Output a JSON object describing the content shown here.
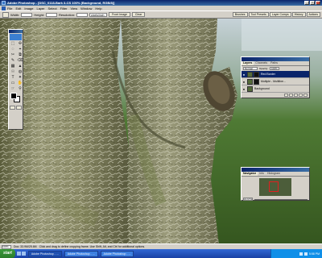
{
  "window": {
    "title": "Adobe Photoshop - [DSC_0118-Bark 3-CS 100% (Background, RGB/8)]",
    "minimize": "_",
    "maximize": "□",
    "close": "x"
  },
  "menu": {
    "items": [
      "File",
      "Edit",
      "Image",
      "Layer",
      "Select",
      "Filter",
      "View",
      "Window",
      "Help"
    ]
  },
  "options_bar": {
    "width_label": "Width:",
    "width_value": "",
    "height_label": "Height:",
    "height_value": "",
    "resolution_label": "Resolution:",
    "resolution_value": "",
    "resolution_units": "pixels/inch",
    "front_image_button": "Front Image",
    "clear_button": "Clear"
  },
  "palette_well": {
    "tabs": [
      "Brushes",
      "Tool Presets",
      "Layer Comps",
      "History",
      "Actions"
    ]
  },
  "toolbox": {
    "tools": [
      "⬚",
      "✣",
      "◌",
      "⌖",
      "✂",
      "⧉",
      "✎",
      "⌫",
      "▦",
      "▲",
      "☉",
      "◍",
      "T",
      "✦",
      "▭",
      "✋",
      "☞",
      "⚲"
    ]
  },
  "layers_panel": {
    "tabs": [
      "Layers",
      "Channels",
      "Paths"
    ],
    "blend_mode": "Normal",
    "opacity_label": "Opacity:",
    "opacity_value": "100%",
    "lock_label": "Lock:",
    "fill_label": "Fill:",
    "fill_value": "100%",
    "layers": [
      {
        "name": "Red Border",
        "selected": true,
        "eye": "●"
      },
      {
        "name": "Multiple - Multiline...",
        "selected": false,
        "eye": "●"
      },
      {
        "name": "Background",
        "selected": false,
        "eye": "●"
      }
    ]
  },
  "navigator_panel": {
    "tabs": [
      "Navigator",
      "Info",
      "Histogram"
    ],
    "zoom_value": "16.67%"
  },
  "status_bar": {
    "zoom": "100%",
    "doc_info": "Doc: 33.9M/25.6M",
    "hint": "Click and drag to define cropping frame. Use Shift, Alt, and Ctrl for additional options."
  },
  "taskbar": {
    "start_label": "start",
    "tasks": [
      "Adobe Photoshop - ...",
      "Adobe Photoshop - ...",
      "Adobe Photoshop - ..."
    ],
    "clock": "5:58 PM"
  },
  "colors": {
    "title_bar": "#0a246a",
    "taskbar": "#245edb",
    "background_grass": "#3f6b2a",
    "bark": "#8a8a63"
  }
}
